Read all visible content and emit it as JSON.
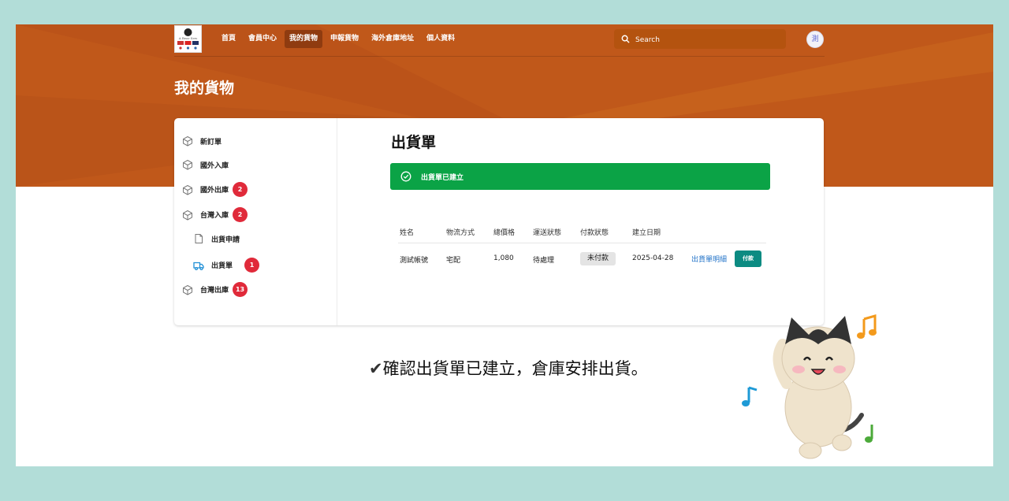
{
  "nav": {
    "logo": {
      "icon": "dog-logo-icon",
      "text": "A Bear Sew"
    },
    "links": [
      {
        "label": "首頁",
        "active": false
      },
      {
        "label": "會員中心",
        "active": false
      },
      {
        "label": "我的貨物",
        "active": true
      },
      {
        "label": "申報貨物",
        "active": false
      },
      {
        "label": "海外倉庫地址",
        "active": false
      },
      {
        "label": "個人資料",
        "active": false
      }
    ],
    "search_placeholder": "Search",
    "avatar_label": "測"
  },
  "page": {
    "title": "我的貨物"
  },
  "sidebar": {
    "items": [
      {
        "label": "新訂單",
        "icon": "box-icon"
      },
      {
        "label": "國外入庫",
        "icon": "box-icon"
      },
      {
        "label": "國外出庫",
        "icon": "box-icon",
        "badge": "2"
      },
      {
        "label": "台灣入庫",
        "icon": "box-icon",
        "badge": "2"
      },
      {
        "label": "出貨申請",
        "icon": "document-icon",
        "sub": true
      },
      {
        "label": "出貨單",
        "icon": "truck-icon",
        "sub": true,
        "badge": "1",
        "active": true
      },
      {
        "label": "台灣出庫",
        "icon": "box-icon",
        "badge": "13"
      }
    ]
  },
  "main": {
    "title": "出貨單",
    "alert": "出貨單已建立",
    "table": {
      "headers": [
        "姓名",
        "物流方式",
        "總價格",
        "運送狀態",
        "付款狀態",
        "建立日期"
      ],
      "row": {
        "name": "測試帳號",
        "shipping": "宅配",
        "total": "1,080",
        "status": "待處理",
        "payment": "未付款",
        "date": "2025-04-28",
        "detail_link": "出貨單明細",
        "pay_button": "付款"
      }
    }
  },
  "caption": {
    "check": "✔",
    "text": "確認出貨單已建立，倉庫安排出貨。"
  },
  "colors": {
    "hero": "#c0581a",
    "active_nav": "#8f3b10",
    "success": "#0ba346",
    "badge": "#e02a3a",
    "pay_button": "#0c8b82",
    "frame": "#b2ddd8"
  }
}
